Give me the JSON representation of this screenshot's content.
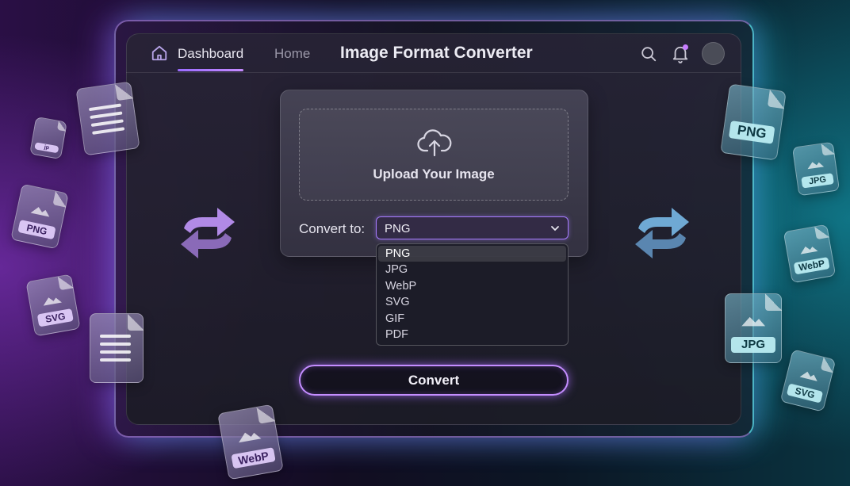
{
  "header": {
    "nav": [
      {
        "label": "Dashboard",
        "active": true
      },
      {
        "label": "Home",
        "active": false
      }
    ],
    "title": "Image Format Converter",
    "icons": [
      "home-icon",
      "search-icon",
      "bell-icon",
      "avatar"
    ]
  },
  "upload": {
    "label": "Upload Your Image",
    "icon": "cloud-upload-icon"
  },
  "convert": {
    "label": "Convert to:",
    "selected": "PNG",
    "options": [
      "PNG",
      "JPG",
      "WebP",
      "SVG",
      "GIF",
      "PDF"
    ],
    "button_label": "Convert"
  },
  "decor_files": {
    "left": [
      "jp",
      "PNG",
      "SVG",
      "WebP"
    ],
    "right": [
      "PNG",
      "JPG",
      "WebP",
      "JPG",
      "SVG"
    ]
  },
  "colors": {
    "accent_purple": "#a67bff",
    "accent_teal": "#3fd6e6",
    "background": "#120d22"
  }
}
